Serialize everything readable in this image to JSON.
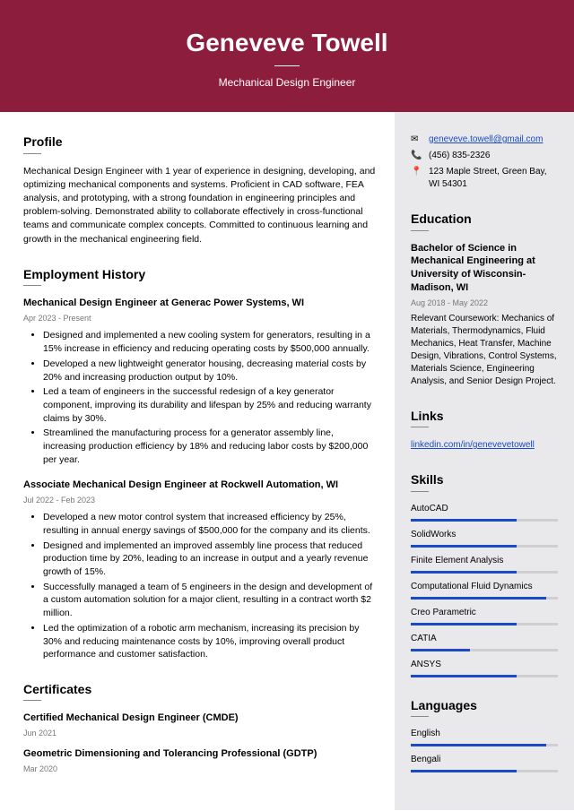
{
  "header": {
    "name": "Geneveve Towell",
    "subtitle": "Mechanical Design Engineer"
  },
  "profile": {
    "heading": "Profile",
    "text": "Mechanical Design Engineer with 1 year of experience in designing, developing, and optimizing mechanical components and systems. Proficient in CAD software, FEA analysis, and prototyping, with a strong foundation in engineering principles and problem-solving. Demonstrated ability to collaborate effectively in cross-functional teams and communicate complex concepts. Committed to continuous learning and growth in the mechanical engineering field."
  },
  "employment": {
    "heading": "Employment History",
    "jobs": [
      {
        "title": "Mechanical Design Engineer at Generac Power Systems, WI",
        "dates": "Apr 2023 - Present",
        "bullets": [
          "Designed and implemented a new cooling system for generators, resulting in a 15% increase in efficiency and reducing operating costs by $500,000 annually.",
          "Developed a new lightweight generator housing, decreasing material costs by 20% and increasing production output by 10%.",
          "Led a team of engineers in the successful redesign of a key generator component, improving its durability and lifespan by 25% and reducing warranty claims by 30%.",
          "Streamlined the manufacturing process for a generator assembly line, increasing production efficiency by 18% and reducing labor costs by $200,000 per year."
        ]
      },
      {
        "title": "Associate Mechanical Design Engineer at Rockwell Automation, WI",
        "dates": "Jul 2022 - Feb 2023",
        "bullets": [
          "Developed a new motor control system that increased efficiency by 25%, resulting in annual energy savings of $500,000 for the company and its clients.",
          "Designed and implemented an improved assembly line process that reduced production time by 20%, leading to an increase in output and a yearly revenue growth of 15%.",
          "Successfully managed a team of 5 engineers in the design and development of a custom automation solution for a major client, resulting in a contract worth $2 million.",
          "Led the optimization of a robotic arm mechanism, increasing its precision by 30% and reducing maintenance costs by 10%, improving overall product performance and customer satisfaction."
        ]
      }
    ]
  },
  "certificates": {
    "heading": "Certificates",
    "items": [
      {
        "title": "Certified Mechanical Design Engineer (CMDE)",
        "date": "Jun 2021"
      },
      {
        "title": "Geometric Dimensioning and Tolerancing Professional (GDTP)",
        "date": "Mar 2020"
      }
    ]
  },
  "contact": {
    "email": "geneveve.towell@gmail.com",
    "phone": "(456) 835-2326",
    "address": "123 Maple Street, Green Bay, WI 54301"
  },
  "education": {
    "heading": "Education",
    "degree": "Bachelor of Science in Mechanical Engineering at University of Wisconsin-Madison, WI",
    "dates": "Aug 2018 - May 2022",
    "text": "Relevant Coursework: Mechanics of Materials, Thermodynamics, Fluid Mechanics, Heat Transfer, Machine Design, Vibrations, Control Systems, Materials Science, Engineering Analysis, and Senior Design Project."
  },
  "links": {
    "heading": "Links",
    "items": [
      "linkedin.com/in/genevevetowell"
    ]
  },
  "skills": {
    "heading": "Skills",
    "items": [
      {
        "name": "AutoCAD",
        "level": 72
      },
      {
        "name": "SolidWorks",
        "level": 72
      },
      {
        "name": "Finite Element Analysis",
        "level": 72
      },
      {
        "name": "Computational Fluid Dynamics",
        "level": 92
      },
      {
        "name": "Creo Parametric",
        "level": 72
      },
      {
        "name": "CATIA",
        "level": 40
      },
      {
        "name": "ANSYS",
        "level": 72
      }
    ]
  },
  "languages": {
    "heading": "Languages",
    "items": [
      {
        "name": "English",
        "level": 92
      },
      {
        "name": "Bengali",
        "level": 72
      }
    ]
  }
}
